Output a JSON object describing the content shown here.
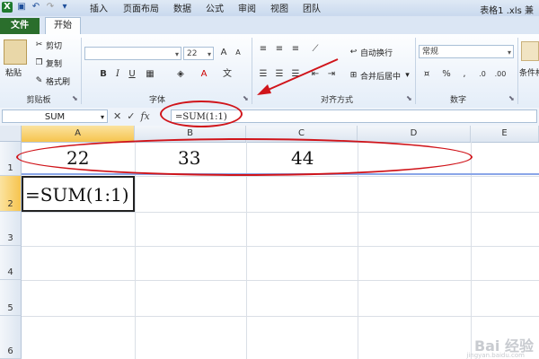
{
  "window": {
    "title": "表格1 .xls 兼"
  },
  "tabs": [
    "文件",
    "开始",
    "插入",
    "页面布局",
    "数据",
    "公式",
    "审阅",
    "视图",
    "团队"
  ],
  "ribbon": {
    "clipboard": {
      "paste": "粘贴",
      "cut": "剪切",
      "copy": "复制",
      "format_painter": "格式刷",
      "label": "剪贴板"
    },
    "font": {
      "font_size": "22",
      "bold": "B",
      "italic": "I",
      "underline": "U",
      "font_color": "A",
      "label": "字体"
    },
    "alignment": {
      "wrap_text": "自动换行",
      "merge_center": "合并后居中",
      "label": "对齐方式"
    },
    "number": {
      "format": "常规",
      "label": "数字"
    },
    "styles": {
      "conditional": "条件格"
    }
  },
  "formula_bar": {
    "name_box": "SUM",
    "formula": "=SUM(1:1)"
  },
  "grid": {
    "columns": [
      "A",
      "B",
      "C",
      "D",
      "E"
    ],
    "rows": [
      "1",
      "2",
      "3",
      "4",
      "5",
      "6"
    ],
    "cells": {
      "A1": "22",
      "B1": "33",
      "C1": "44",
      "A2": "=SUM(1:1)"
    }
  },
  "colors": {
    "file_tab": "#2a6e2c",
    "annotation": "#d0141a",
    "active_header": "#f6c44e"
  },
  "watermark": {
    "main": "Bai 经验",
    "sub": "jingyan.baidu.com"
  }
}
